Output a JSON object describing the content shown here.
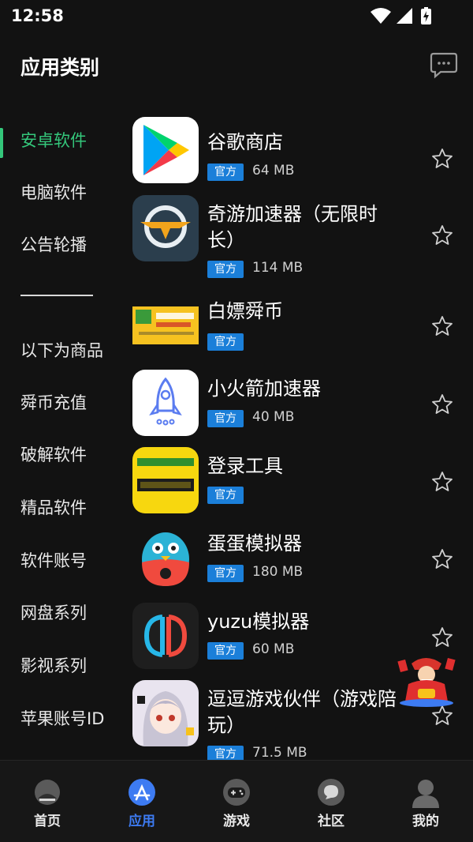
{
  "status_bar": {
    "time": "12:58"
  },
  "header": {
    "title": "应用类别"
  },
  "sidebar": {
    "items": [
      {
        "label": "安卓软件",
        "active": true
      },
      {
        "label": "电脑软件"
      },
      {
        "label": "公告轮播"
      },
      {
        "label": "以下为商品"
      },
      {
        "label": "舜币充值"
      },
      {
        "label": "破解软件"
      },
      {
        "label": "精品软件"
      },
      {
        "label": "软件账号"
      },
      {
        "label": "网盘系列"
      },
      {
        "label": "影视系列"
      },
      {
        "label": "苹果账号ID"
      }
    ]
  },
  "apps": [
    {
      "name": "谷歌商店",
      "badge": "官方",
      "size": "64 MB",
      "icon": "google-play-icon"
    },
    {
      "name": "奇游加速器（无限时长）",
      "badge": "官方",
      "size": "114 MB",
      "icon": "qiyou-accelerator-icon"
    },
    {
      "name": "白嫖舜币",
      "badge": "官方",
      "size": "",
      "icon": "promo-banner-icon"
    },
    {
      "name": "小火箭加速器",
      "badge": "官方",
      "size": "40 MB",
      "icon": "rocket-icon"
    },
    {
      "name": "登录工具",
      "badge": "官方",
      "size": "",
      "icon": "login-tool-icon"
    },
    {
      "name": "蛋蛋模拟器",
      "badge": "官方",
      "size": "180 MB",
      "icon": "egg-emulator-icon"
    },
    {
      "name": "yuzu模拟器",
      "badge": "官方",
      "size": "60 MB",
      "icon": "yuzu-icon"
    },
    {
      "name": "逗逗游戏伙伴（游戏陪玩）",
      "badge": "官方",
      "size": "71.5 MB",
      "icon": "anime-girl-icon"
    }
  ],
  "bottom_nav": [
    {
      "label": "首页",
      "icon": "home-icon"
    },
    {
      "label": "应用",
      "icon": "app-store-icon",
      "active": true
    },
    {
      "label": "游戏",
      "icon": "gamepad-icon"
    },
    {
      "label": "社区",
      "icon": "community-chat-icon"
    },
    {
      "label": "我的",
      "icon": "profile-icon"
    }
  ],
  "colors": {
    "accent_green": "#34c77b",
    "badge_blue": "#1b7fd9",
    "nav_active": "#3d7bf2",
    "background": "#121212"
  }
}
